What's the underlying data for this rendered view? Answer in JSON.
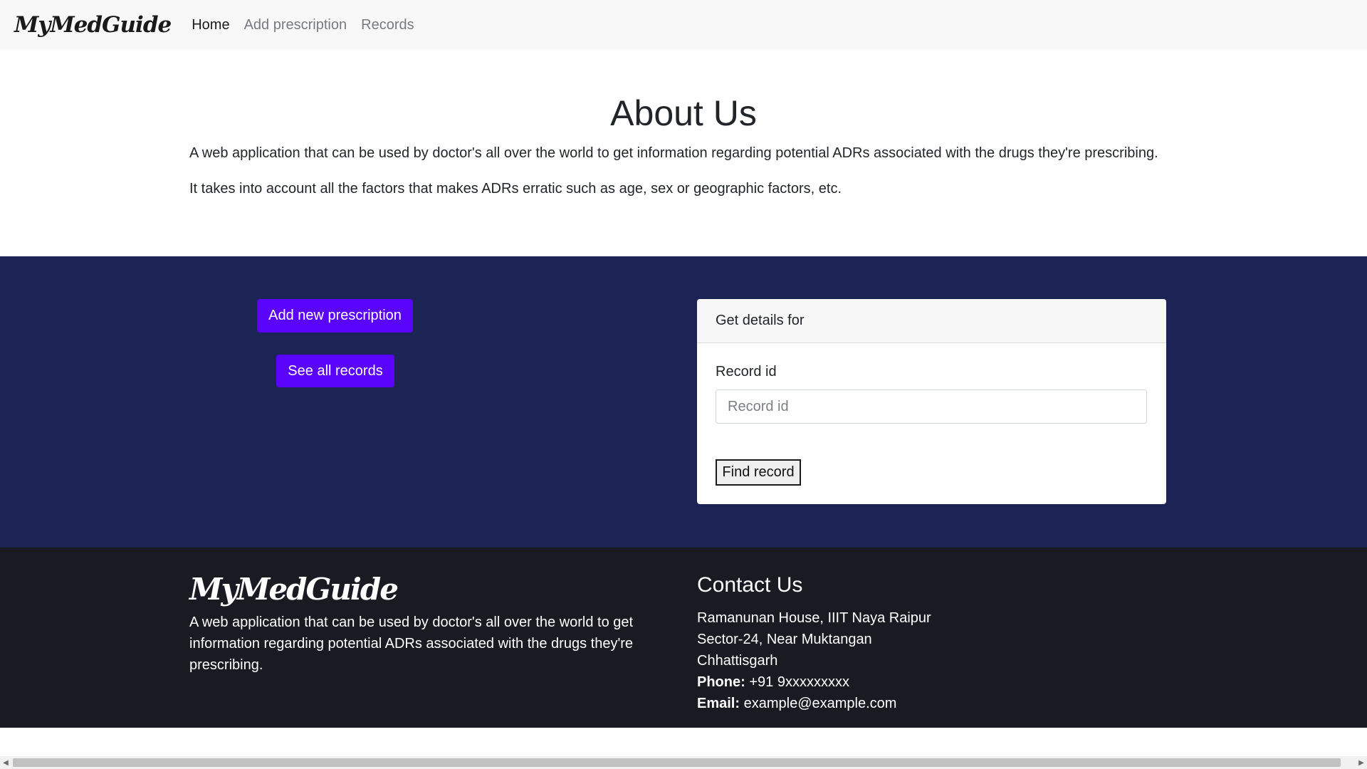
{
  "navbar": {
    "brand": "MyMedGuide",
    "links": [
      "Home",
      "Add prescription",
      "Records"
    ]
  },
  "about": {
    "title": "About Us",
    "paragraphs": [
      "A web application that can be used by doctor's all over the world to get information regarding potential ADRs associated with the drugs they're prescribing.",
      "It takes into account all the factors that makes ADRs erratic such as age, sex or geographic factors, etc."
    ]
  },
  "actions": {
    "add_button": "Add new prescription",
    "records_button": "See all records"
  },
  "record_card": {
    "header": "Get details for",
    "label": "Record id",
    "placeholder": "Record id",
    "value": "",
    "submit": "Find record"
  },
  "footer": {
    "brand": "MyMedGuide",
    "description": "A web application that can be used by doctor's all over the world to get information regarding potential ADRs associated with the drugs they're prescribing.",
    "contact": {
      "title": "Contact Us",
      "address_lines": [
        "Ramanunan House, IIIT Naya Raipur",
        "Sector-24, Near Muktangan",
        "Chhattisgarh"
      ],
      "phone_label": "Phone:",
      "phone": "+91 9xxxxxxxxx",
      "email_label": "Email:",
      "email": "example@example.com"
    }
  },
  "colors": {
    "navbar_bg": "#f8f8f9",
    "band_bg": "#1c2456",
    "button_purple": "#5a04fb",
    "footer_bg": "#1a1a22"
  },
  "icons": [
    "scroll-left-arrow-icon",
    "scroll-right-arrow-icon"
  ]
}
